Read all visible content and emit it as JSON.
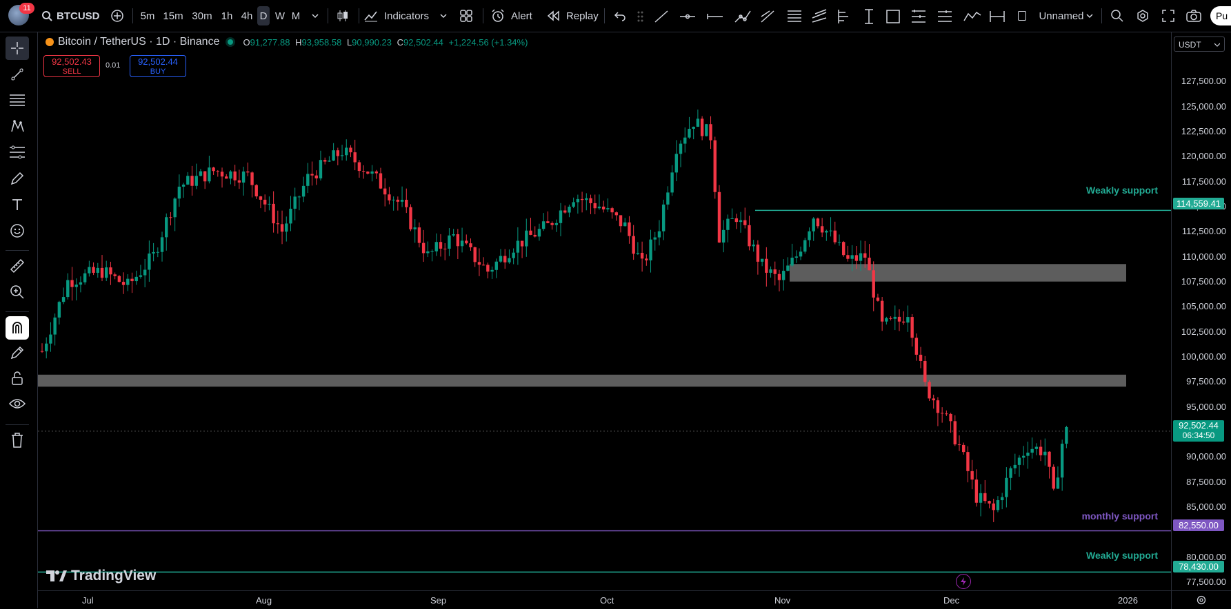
{
  "header": {
    "notification_count": "11",
    "symbol": "BTCUSD",
    "timeframes": [
      "5m",
      "15m",
      "30m",
      "1h",
      "4h",
      "D",
      "W",
      "M"
    ],
    "active_timeframe": "D",
    "indicators_label": "Indicators",
    "alert_label": "Alert",
    "replay_label": "Replay",
    "layout_name": "Unnamed",
    "publish_label": "Pu"
  },
  "legend": {
    "title": "Bitcoin / TetherUS · 1D · Binance",
    "o_label": "O",
    "o": "91,277.88",
    "h_label": "H",
    "h": "93,958.58",
    "l_label": "L",
    "l": "90,990.23",
    "c_label": "C",
    "c": "92,502.44",
    "change": "+1,224.56 (+1.34%)"
  },
  "trade": {
    "sell_price": "92,502.43",
    "sell_label": "SELL",
    "spread": "0.01",
    "buy_price": "92,502.44",
    "buy_label": "BUY"
  },
  "currency": "USDT",
  "price_axis": [
    "127,500.00",
    "125,000.00",
    "122,500.00",
    "120,000.00",
    "117,500.00",
    "115,000.00",
    "112,500.00",
    "110,000.00",
    "107,500.00",
    "105,000.00",
    "102,500.00",
    "100,000.00",
    "97,500.00",
    "95,000.00",
    "90,000.00",
    "87,500.00",
    "85,000.00",
    "80,000.00",
    "77,500.00"
  ],
  "time_axis": [
    "Jul",
    "Aug",
    "Sep",
    "Oct",
    "Nov",
    "Dec",
    "2026"
  ],
  "tags": {
    "weekly_top": "114,559.41",
    "last_price": "92,502.44",
    "countdown": "06:34:50",
    "monthly": "82,550.00",
    "weekly_bottom": "78,430.00"
  },
  "annotations": {
    "weekly_top_label": "Weakly support",
    "monthly_label": "monthly support",
    "weekly_bottom_label": "Weakly support"
  },
  "watermark": "TradingView",
  "colors": {
    "up": "#089981",
    "down": "#f23645",
    "weekly_line": "#22ab94",
    "monthly_line": "#7e57c2",
    "zone": "#5d5d5d",
    "buy": "#2962ff"
  },
  "icons": {
    "search": "search-icon",
    "add": "plus-circle-icon",
    "bars": "candles-icon",
    "indicators": "indicators-icon",
    "templates": "templates-icon",
    "alert": "alarm-icon",
    "replay": "replay-icon",
    "undo": "undo-icon"
  }
}
